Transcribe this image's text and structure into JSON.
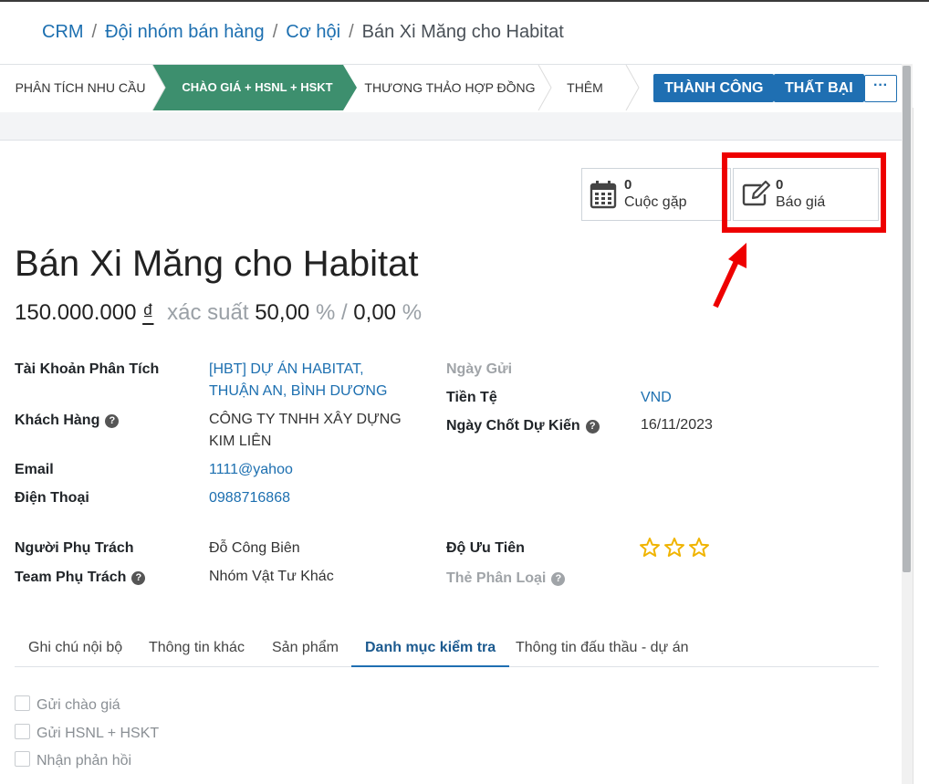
{
  "breadcrumb": {
    "crm": "CRM",
    "team": "Đội nhóm bán hàng",
    "opportunity": "Cơ hội",
    "current": "Bán Xi Măng cho Habitat"
  },
  "statusbar": {
    "stages": [
      "PHÂN TÍCH NHU CẦU",
      "CHÀO GIÁ + HSNL + HSKT",
      "THƯƠNG THẢO HỢP ĐỒNG",
      "THÊM"
    ],
    "active_stage": "CHÀO GIÁ + HSNL + HSKT",
    "won": "THÀNH CÔNG",
    "lost": "THẤT BẠI",
    "more": "···"
  },
  "smart_buttons": {
    "meetings": {
      "count": "0",
      "label": "Cuộc gặp"
    },
    "quotes": {
      "count": "0",
      "label": "Báo giá"
    }
  },
  "record": {
    "title": "Bán Xi Măng cho Habitat",
    "revenue": "150.000.000",
    "currency_symbol": "₫",
    "probability_label": "xác suất",
    "probability": "50,00",
    "percent": "%",
    "slash": "/",
    "probability_2": "0,00"
  },
  "fields": {
    "analytic_account_label": "Tài Khoản Phân Tích",
    "analytic_account_line1": "[HBT] DỰ ÁN HABITAT,",
    "analytic_account_line2": "THUẬN AN, BÌNH DƯƠNG",
    "customer_label": "Khách Hàng",
    "customer_line1": "CÔNG TY TNHH XÂY DỰNG",
    "customer_line2": "KIM LIÊN",
    "email_label": "Email",
    "email": "1111@yahoo",
    "phone_label": "Điện Thoại",
    "phone": "0988716868",
    "salesperson_label": "Người Phụ Trách",
    "salesperson": "Đỗ Công Biên",
    "team_label": "Team Phụ Trách",
    "team": "Nhóm Vật Tư Khác",
    "send_date_label": "Ngày Gửi",
    "currency_label": "Tiền Tệ",
    "currency": "VND",
    "deadline_label": "Ngày Chốt Dự Kiến",
    "deadline": "16/11/2023",
    "priority_label": "Độ Ưu Tiên",
    "priority_stars": 0,
    "tags_label": "Thẻ Phân Loại",
    "help": "?"
  },
  "tabs": [
    "Ghi chú nội bộ",
    "Thông tin khác",
    "Sản phẩm",
    "Danh mục kiểm tra",
    "Thông tin đấu thầu - dự án"
  ],
  "active_tab": "Danh mục kiểm tra",
  "checklist": [
    "Gửi chào giá",
    "Gửi HSNL + HSKT",
    "Nhận phản hồi"
  ],
  "colors": {
    "accent": "#1f6fb2",
    "active_stage": "#3d8f6e",
    "highlight": "#ee0000"
  }
}
